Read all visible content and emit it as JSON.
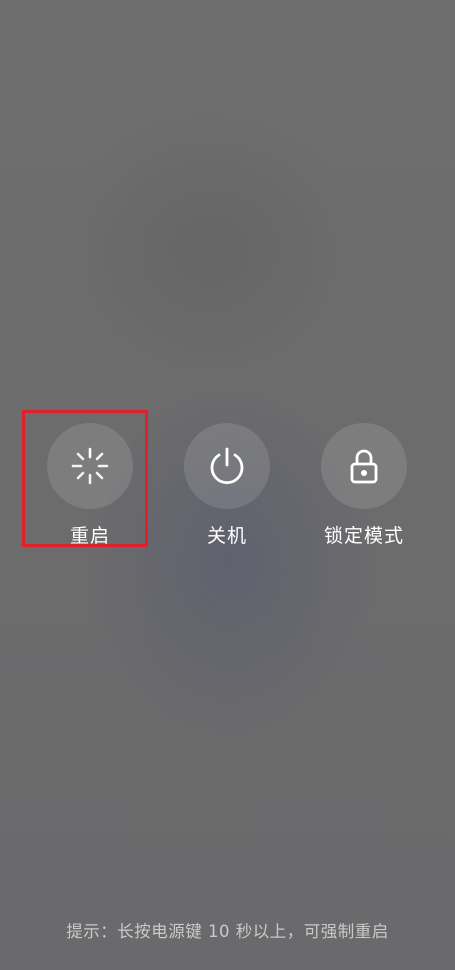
{
  "power_menu": {
    "options": [
      {
        "label": "重启",
        "icon": "restart-spinner-icon"
      },
      {
        "label": "关机",
        "icon": "power-icon"
      },
      {
        "label": "锁定模式",
        "icon": "lock-icon"
      }
    ],
    "highlighted_option": "重启",
    "highlight_color": "#e0202a"
  },
  "hint": {
    "text": "提示：长按电源键 10 秒以上，可强制重启"
  }
}
